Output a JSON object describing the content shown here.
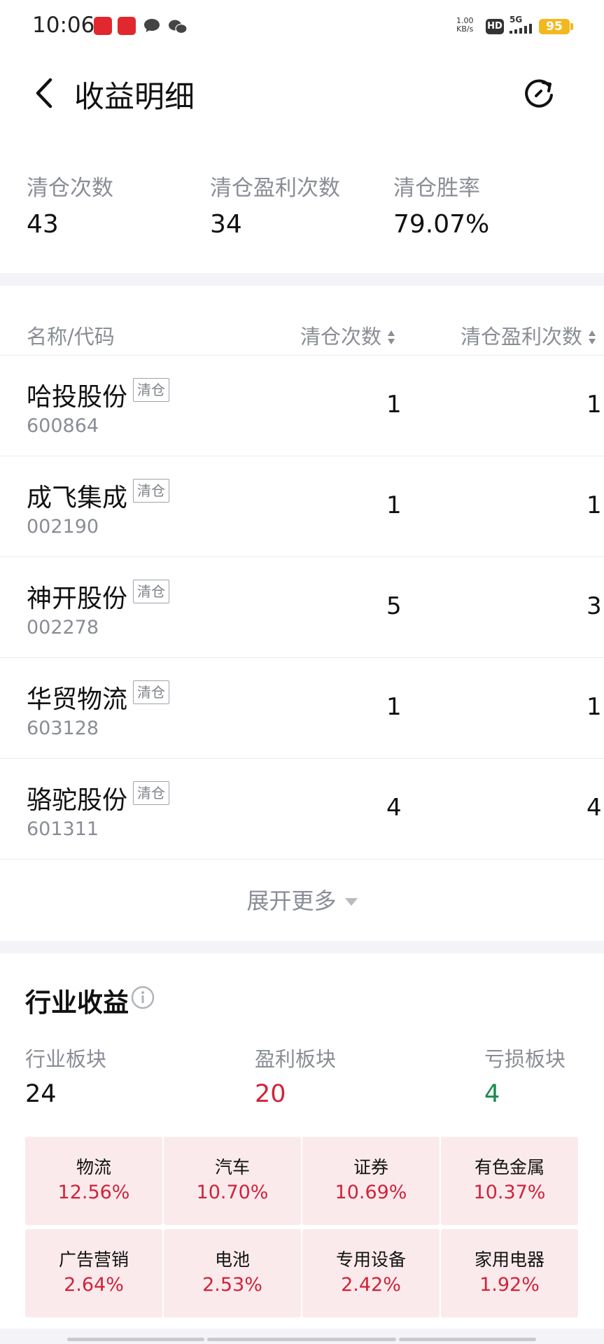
{
  "status_bar": {
    "time": "10:06",
    "net_speed_value": "1.00",
    "net_speed_unit": "KB/s",
    "hd": "HD",
    "signal": "5G",
    "battery": "95"
  },
  "header": {
    "title": "收益明细",
    "back_icon": "chevron-left-icon",
    "refresh_icon": "refresh-icon"
  },
  "summary": [
    {
      "label": "清仓次数",
      "value": "43"
    },
    {
      "label": "清仓盈利次数",
      "value": "34"
    },
    {
      "label": "清仓胜率",
      "value": "79.07%"
    }
  ],
  "table": {
    "columns": [
      "名称/代码",
      "清仓次数",
      "清仓盈利次数"
    ],
    "tag_label": "清仓",
    "rows": [
      {
        "name": "哈投股份",
        "code": "600864",
        "count": "1",
        "profit_count": "1"
      },
      {
        "name": "成飞集成",
        "code": "002190",
        "count": "1",
        "profit_count": "1"
      },
      {
        "name": "神开股份",
        "code": "002278",
        "count": "5",
        "profit_count": "3"
      },
      {
        "name": "华贸物流",
        "code": "603128",
        "count": "1",
        "profit_count": "1"
      },
      {
        "name": "骆驼股份",
        "code": "601311",
        "count": "4",
        "profit_count": "4"
      }
    ],
    "expand_label": "展开更多"
  },
  "industry": {
    "title": "行业收益",
    "stats": [
      {
        "label": "行业板块",
        "value": "24"
      },
      {
        "label": "盈利板块",
        "value": "20"
      },
      {
        "label": "亏损板块",
        "value": "4"
      }
    ],
    "tiles": [
      {
        "name": "物流",
        "pct": "12.56%"
      },
      {
        "name": "汽车",
        "pct": "10.70%"
      },
      {
        "name": "证券",
        "pct": "10.69%"
      },
      {
        "name": "有色金属",
        "pct": "10.37%"
      },
      {
        "name": "广告营销",
        "pct": "2.64%"
      },
      {
        "name": "电池",
        "pct": "2.53%"
      },
      {
        "name": "专用设备",
        "pct": "2.42%"
      },
      {
        "name": "家用电器",
        "pct": "1.92%"
      }
    ]
  },
  "colors": {
    "profit_red": "#d0233a",
    "loss_green": "#1a8c4e",
    "tile_bg": "#fbeaec",
    "muted_text": "#8a8d96"
  }
}
